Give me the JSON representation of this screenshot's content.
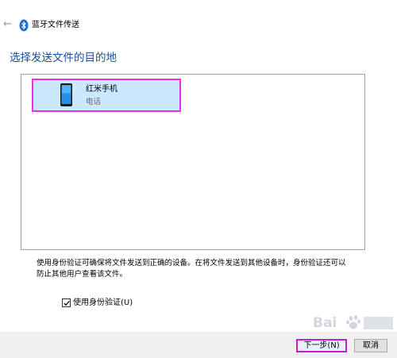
{
  "window": {
    "title": "蓝牙文件传送",
    "back_icon": "arrow-left-icon",
    "bluetooth_icon": "bluetooth-icon"
  },
  "heading": "选择发送文件的目的地",
  "devices": [
    {
      "name": "红米手机",
      "type": "电话",
      "icon": "phone-icon",
      "selected": true
    }
  ],
  "info": {
    "line1": "使用身份验证可确保将文件发送到正确的设备。在将文件发送到其他设备时，身份验证还可以",
    "line2": "防止其他用户查看该文件。"
  },
  "auth": {
    "label": "使用身份验证(U)",
    "checked": true
  },
  "buttons": {
    "next": "下一步(N)",
    "cancel": "取消"
  },
  "colors": {
    "heading": "#1a4fa0",
    "selection_bg": "#cce8ff",
    "highlight": "#e431e8",
    "footer_bg": "#f0f0f0"
  },
  "watermark": {
    "text": "Bai"
  }
}
